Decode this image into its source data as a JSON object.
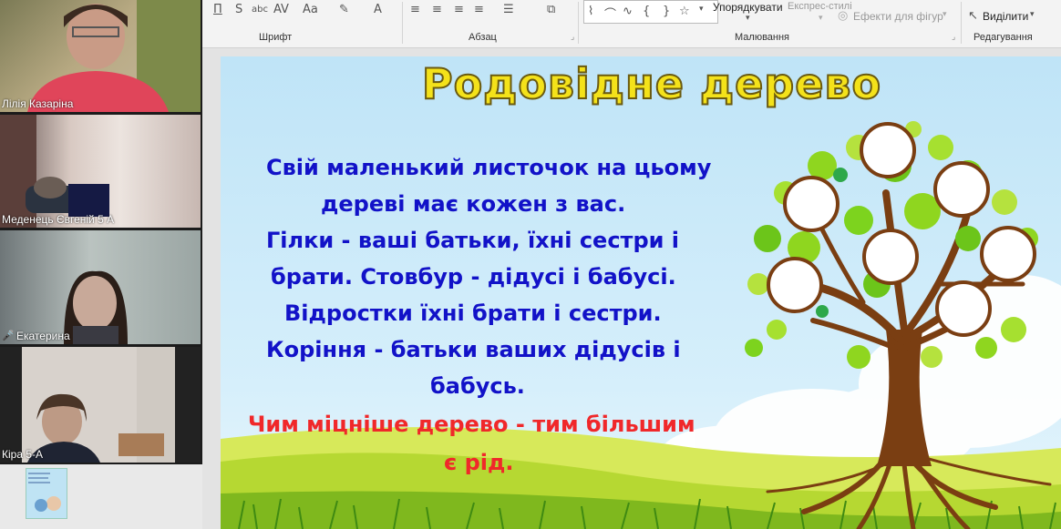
{
  "participants": [
    {
      "name": "Лілія Казаріна",
      "muted": false
    },
    {
      "name": "Меденець Євгеній 5 А",
      "muted": false
    },
    {
      "name": "Екатерина",
      "muted": true
    },
    {
      "name": "Кіра 5-А",
      "muted": false
    }
  ],
  "ribbon": {
    "groups": [
      "Шрифт",
      "Абзац",
      "Малювання",
      "Редагування"
    ],
    "arrange_label": "Упорядкувати",
    "express_styles_label": "Експрес-стилі",
    "shape_effects_label": "Ефекти для фігур",
    "select_label": "Виділити"
  },
  "slide": {
    "title": "Родовідне дерево",
    "lines": [
      "Свій маленький листочок на цьому",
      "дереві має кожен з вас.",
      "Гілки - ваші батьки, їхні сестри і",
      "брати. Стовбур - дідусі і бабусі.",
      "Відростки їхні брати і сестри.",
      "Коріння - батьки ваших дідусів і",
      "бабусь."
    ],
    "highlight_lines": [
      "Чим міцніше дерево - тим більшим",
      "є рід."
    ]
  },
  "colors": {
    "title_yellow": "#f4e21a",
    "body_blue": "#1212c8",
    "highlight_red": "#f0282a",
    "leaf_green": "#7dd31e",
    "trunk_brown": "#7a3e12"
  }
}
